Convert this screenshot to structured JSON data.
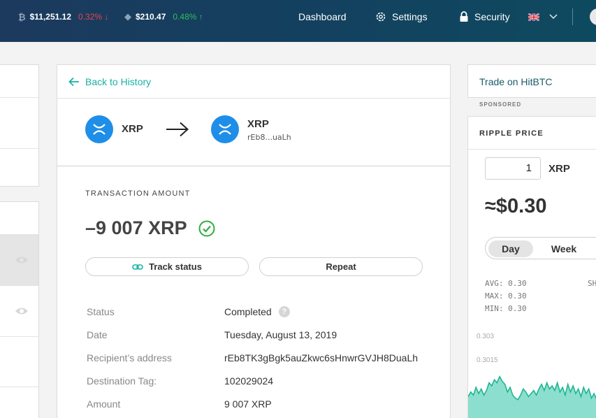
{
  "ticker": {
    "btc": {
      "icon": "bitcoin-icon",
      "price": "$11,251.12",
      "change": "0.32% ↓",
      "color": "#e8444b"
    },
    "eth": {
      "icon": "ethereum-icon",
      "price": "$210.47",
      "change": "0.48% ↑",
      "color": "#2fbe5a"
    }
  },
  "nav": {
    "dashboard": "Dashboard",
    "settings": "Settings",
    "security": "Security",
    "language_flag": "uk-flag-icon"
  },
  "transaction": {
    "back_label": "Back to History",
    "from_coin": "XRP",
    "to_coin": "XRP",
    "to_address_short": "rEb8...uaLh",
    "amount_label": "TRANSACTION AMOUNT",
    "amount": "–9 007 XRP",
    "track_label": "Track status",
    "repeat_label": "Repeat",
    "details": [
      {
        "key": "Status",
        "value": "Completed"
      },
      {
        "key": "Date",
        "value": "Tuesday, August 13, 2019"
      },
      {
        "key": "Recipient’s address",
        "value": "rEb8TK3gBgk5auZkwc6sHnwrGVJH8DuaLh"
      },
      {
        "key": "Destination Tag:",
        "value": "102029024"
      },
      {
        "key": "Amount",
        "value": "9 007 XRP"
      }
    ],
    "status_help": "?"
  },
  "sidebar_right": {
    "trade_label": "Trade on HitBTC",
    "sponsored": "SPONSORED",
    "price_title": "RIPPLE PRICE",
    "qty_value": "1",
    "qty_unit": "XRP",
    "converted_price": "≈$0.30",
    "period_day": "Day",
    "period_week": "Week",
    "stats": {
      "avg": "AVG: 0.30",
      "max": "MAX: 0.30",
      "min": "MIN: 0.30",
      "right_partial": "SH"
    },
    "axis_ticks": [
      "0.303",
      "0.3015"
    ]
  },
  "chart_data": {
    "type": "area",
    "title": "",
    "color": "#2ec4a5",
    "ylim": [
      0.2985,
      0.3035
    ],
    "values": [
      0.3003,
      0.3006,
      0.3004,
      0.3009,
      0.3005,
      0.3008,
      0.3004,
      0.3007,
      0.3012,
      0.301,
      0.3014,
      0.3012,
      0.3016,
      0.3013,
      0.3011,
      0.3006,
      0.3009,
      0.3004,
      0.3002,
      0.3001,
      0.3004,
      0.3008,
      0.3006,
      0.3003,
      0.3005,
      0.3007,
      0.3004,
      0.3008,
      0.3011,
      0.3007,
      0.3012,
      0.3008,
      0.301,
      0.3007,
      0.3012,
      0.3006,
      0.3009,
      0.3004,
      0.3011,
      0.3006,
      0.301,
      0.3005,
      0.3008,
      0.3003,
      0.3009,
      0.3005,
      0.3008,
      0.3002,
      0.3005,
      0.3001
    ]
  }
}
